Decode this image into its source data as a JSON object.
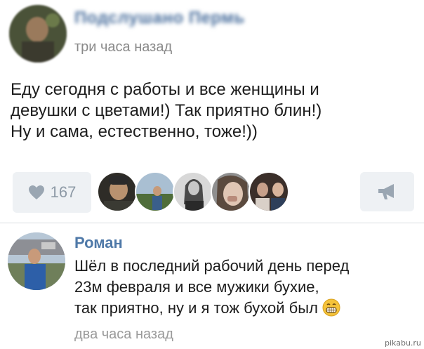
{
  "post": {
    "author": "Подслушано Пермь",
    "time": "три часа назад",
    "text_lines": [
      "Еду сегодня с работы и все женщины и",
      "девушки с цветами!) Так приятно блин!)",
      "Ну и сама, естественно, тоже!))"
    ]
  },
  "actions": {
    "likes_count": "167",
    "like_icon": "heart-icon",
    "share_icon": "megaphone-icon"
  },
  "comment": {
    "author": "Роман",
    "text_lines": [
      "Шёл в последний рабочий день перед",
      "23м февраля и все мужики бухие,",
      "так приятно, ну и я тож бухой был"
    ],
    "emoji": "grin-emoji-icon",
    "time": "два часа назад"
  },
  "watermark": "pikabu.ru",
  "colors": {
    "author_blue": "#4f79a8",
    "button_bg": "#eef1f4",
    "icon_gray": "#8e9aa6",
    "meta_gray": "#8a8a8a"
  }
}
